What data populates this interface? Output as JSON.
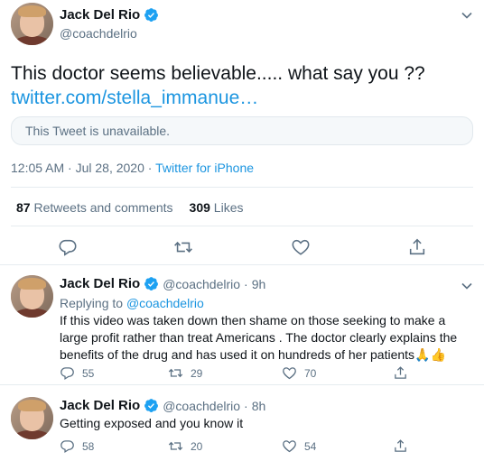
{
  "main_tweet": {
    "name": "Jack Del Rio",
    "handle": "@coachdelrio",
    "text": "This doctor seems believable..... what say you ??",
    "link": "twitter.com/stella_immanue…",
    "quote_unavailable": "This Tweet is unavailable.",
    "timestamp": "12:05 AM · Jul 28, 2020",
    "source": "Twitter for iPhone",
    "retweets_count": "87",
    "retweets_label": "Retweets and comments",
    "likes_count": "309",
    "likes_label": "Likes"
  },
  "replies": [
    {
      "name": "Jack Del Rio",
      "handle": "@coachdelrio",
      "time": "9h",
      "replying_prefix": "Replying to",
      "replying_to": "@coachdelrio",
      "text": "If this video was taken down then shame on those seeking to make a large profit rather than treat Americans . The doctor clearly explains the benefits of the drug and has used it on hundreds of her patients🙏👍",
      "replies_count": "55",
      "retweets_count": "29",
      "likes_count": "70"
    },
    {
      "name": "Jack Del Rio",
      "handle": "@coachdelrio",
      "time": "8h",
      "text": "Getting exposed and you know it",
      "replies_count": "58",
      "retweets_count": "20",
      "likes_count": "54"
    }
  ],
  "separator_dot": "·",
  "colors": {
    "accent": "#1b95e0",
    "muted": "#5b7083",
    "text": "#0f1419",
    "border": "#e6ecf0"
  },
  "icons": [
    "verified-badge-icon",
    "chevron-down-icon",
    "reply-icon",
    "retweet-icon",
    "like-icon",
    "share-icon"
  ]
}
